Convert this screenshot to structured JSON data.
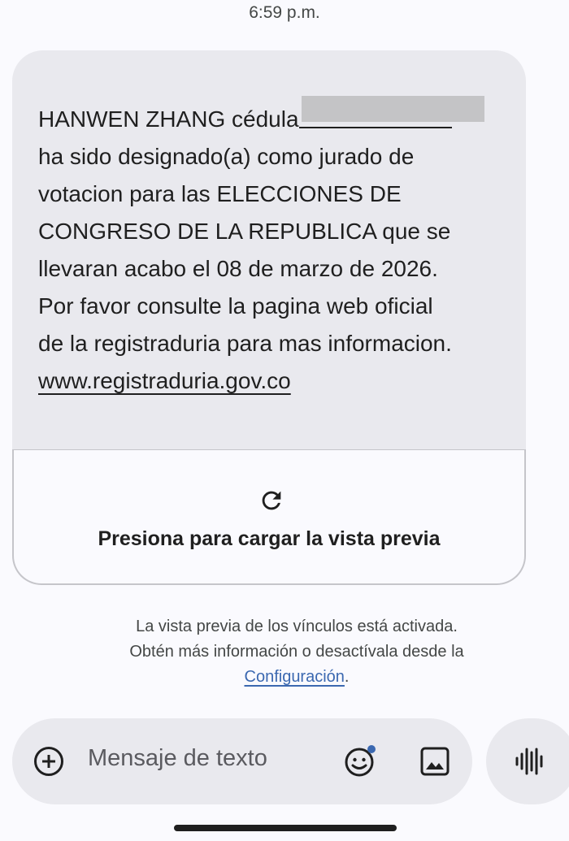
{
  "status": {
    "time": "6:59 p.m."
  },
  "message": {
    "line1_prefix": "HANWEN ZHANG cédula",
    "lines": [
      "ha sido designado(a) como jurado de",
      "votacion para las ELECCIONES DE",
      "CONGRESO DE LA REPUBLICA que se",
      "llevaran acabo el 08 de marzo de 2026.",
      "Por favor consulte la pagina web oficial",
      "de la registraduria para mas informacion."
    ],
    "link": "www.registraduria.gov.co"
  },
  "preview": {
    "label": "Presiona para cargar la vista previa",
    "icon": "reload-icon"
  },
  "info": {
    "line1": "La vista previa de los vínculos está activada.",
    "line2": "Obtén más información o desactívala desde la",
    "link": "Configuración",
    "trailing": "."
  },
  "compose": {
    "placeholder": "Mensaje de texto",
    "icons": [
      "add-icon",
      "emoji-icon",
      "image-icon",
      "voice-icon"
    ]
  },
  "colors": {
    "background": "#fafafe",
    "bubble": "#e9e9ee",
    "link_blue": "#3b68b0",
    "text": "#1f1f1f"
  }
}
